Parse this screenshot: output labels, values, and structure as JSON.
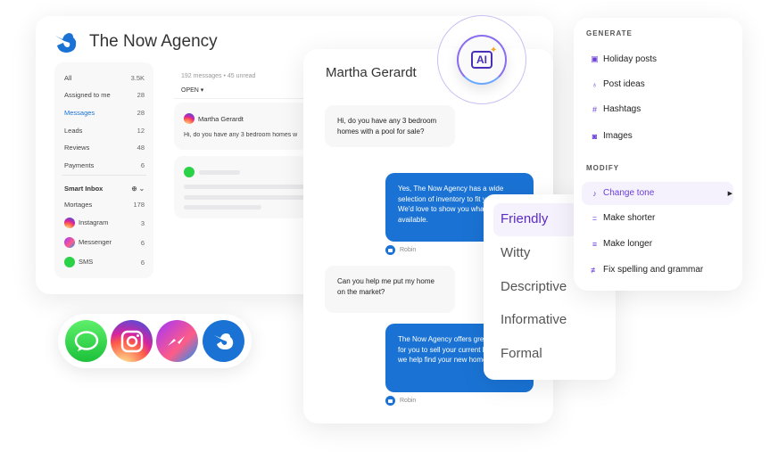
{
  "app": {
    "title": "The Now Agency",
    "brand_color": "#1a73d4",
    "accent_color": "#6b3fd6"
  },
  "sidebar": {
    "items": [
      {
        "label": "All",
        "count": "3.5K"
      },
      {
        "label": "Assigned to me",
        "count": "28"
      },
      {
        "label": "Messages",
        "count": "28",
        "active": true
      },
      {
        "label": "Leads",
        "count": "12"
      },
      {
        "label": "Reviews",
        "count": "48"
      },
      {
        "label": "Payments",
        "count": "6"
      }
    ],
    "smart_inbox": {
      "label": "Smart Inbox",
      "items": [
        {
          "label": "Mortages",
          "count": "178"
        },
        {
          "label": "Instagram",
          "count": "3",
          "icon": "instagram-icon"
        },
        {
          "label": "Messenger",
          "count": "6",
          "icon": "messenger-icon"
        },
        {
          "label": "SMS",
          "count": "6",
          "icon": "sms-icon"
        }
      ]
    }
  },
  "list": {
    "summary": "192 messages • 45 unread",
    "filter": "OPEN",
    "preview": {
      "name": "Martha Gerardt",
      "text": "Hi, do you have any 3 bedroom homes w"
    }
  },
  "chat": {
    "title": "Martha Gerardt",
    "ai_label": "AI",
    "messages": [
      {
        "from": "in",
        "text": "Hi, do you have any 3 bedroom homes with a pool for sale?"
      },
      {
        "from": "out",
        "text": "Yes, The Now Agency has a wide selection of inventory to fit your needs. We'd love to show you what's available.",
        "author": "Robin"
      },
      {
        "from": "in",
        "text": "Can you help me put my home on the market?"
      },
      {
        "from": "out",
        "text": "The Now Agency offers great services for you to sell your current home while we help find your new home.",
        "author": "Robin"
      }
    ]
  },
  "tone_menu": {
    "items": [
      "Friendly",
      "Witty",
      "Descriptive",
      "Informative",
      "Formal"
    ],
    "selected": "Friendly"
  },
  "ai_menu": {
    "generate_label": "GENERATE",
    "generate": [
      {
        "label": "Holiday posts",
        "icon": "calendar-icon"
      },
      {
        "label": "Post ideas",
        "icon": "lightbulb-icon"
      },
      {
        "label": "Hashtags",
        "icon": "hashtag-icon"
      },
      {
        "label": "Images",
        "icon": "image-icon"
      }
    ],
    "modify_label": "MODIFY",
    "modify": [
      {
        "label": "Change tone",
        "icon": "tone-icon",
        "active": true
      },
      {
        "label": "Make shorter",
        "icon": "short-lines-icon"
      },
      {
        "label": "Make longer",
        "icon": "long-lines-icon"
      },
      {
        "label": "Fix spelling and grammar",
        "icon": "spellcheck-icon"
      }
    ]
  },
  "channels": [
    "sms-icon",
    "instagram-icon",
    "messenger-icon",
    "now-agency-icon"
  ]
}
